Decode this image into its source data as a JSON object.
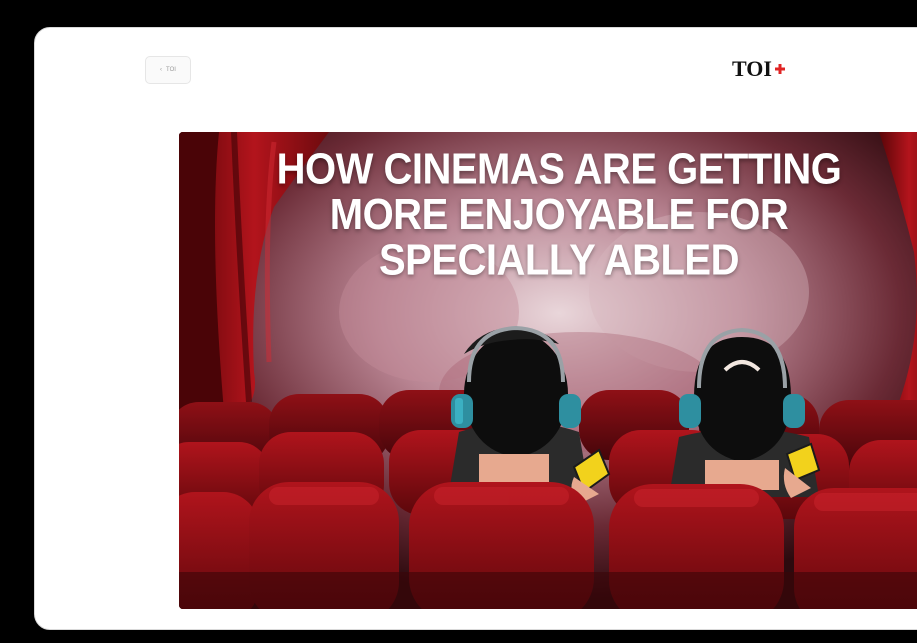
{
  "header": {
    "back_label": "TOI",
    "back_icon": "chevron-left-icon",
    "logo_text": "TOI",
    "logo_mark": "red-plus-icon"
  },
  "hero": {
    "headline_lines": [
      "HOW CINEMAS ARE GETTING",
      "MORE ENJOYABLE FOR",
      "SPECIALLY ABLED"
    ]
  },
  "colors": {
    "page_background": "#000000",
    "card_background": "#ffffff",
    "logo_accent": "#e02424",
    "seat_red": "#8b0f16",
    "headphone_teal": "#2e8fa0",
    "phone_yellow": "#f2d21c"
  }
}
